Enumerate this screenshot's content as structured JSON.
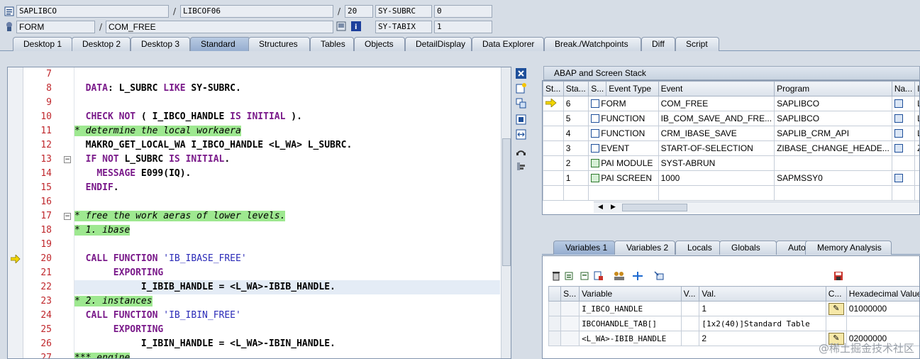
{
  "header": {
    "row1": {
      "program": "SAPLIBCO",
      "include": "LIBCOF06",
      "line": "20",
      "sysvar1": "SY-SUBRC",
      "sysval1": "0"
    },
    "row2": {
      "type": "FORM",
      "name": "COM_FREE",
      "sysvar2": "SY-TABIX",
      "sysval2": "1"
    },
    "sep": "/"
  },
  "tabs": [
    "Desktop 1",
    "Desktop 2",
    "Desktop 3",
    "Standard",
    "Structures",
    "Tables",
    "Objects",
    "DetailDisplay",
    "Data Explorer",
    "Break./Watchpoints",
    "Diff",
    "Script"
  ],
  "editor": {
    "lines": [
      {
        "no": "7",
        "text": ""
      },
      {
        "no": "8",
        "text": "  DATA: L_SUBRC LIKE SY-SUBRC."
      },
      {
        "no": "9",
        "text": ""
      },
      {
        "no": "10",
        "text": "  CHECK NOT ( I_IBCO_HANDLE IS INITIAL )."
      },
      {
        "no": "11",
        "text": "* determine the local workaera"
      },
      {
        "no": "12",
        "text": "  MAKRO_GET_LOCAL_WA I_IBCO_HANDLE <L_WA> L_SUBRC."
      },
      {
        "no": "13",
        "text": "  IF NOT L_SUBRC IS INITIAL."
      },
      {
        "no": "14",
        "text": "    MESSAGE E099(IQ)."
      },
      {
        "no": "15",
        "text": "  ENDIF."
      },
      {
        "no": "16",
        "text": ""
      },
      {
        "no": "17",
        "text": "* free the work aeras of lower levels."
      },
      {
        "no": "18",
        "text": "* 1. ibase"
      },
      {
        "no": "19",
        "text": ""
      },
      {
        "no": "20",
        "text": "  CALL FUNCTION 'IB_IBASE_FREE'"
      },
      {
        "no": "21",
        "text": "       EXPORTING"
      },
      {
        "no": "22",
        "text": "            I_IBIB_HANDLE = <L_WA>-IBIB_HANDLE."
      },
      {
        "no": "23",
        "text": "* 2. instances"
      },
      {
        "no": "24",
        "text": "  CALL FUNCTION 'IB_IBIN_FREE'"
      },
      {
        "no": "25",
        "text": "       EXPORTING"
      },
      {
        "no": "26",
        "text": "            I_IBIN_HANDLE = <L_WA>-IBIN_HANDLE."
      },
      {
        "no": "27",
        "text": "*** engine"
      }
    ]
  },
  "stack": {
    "title": "ABAP and Screen Stack",
    "columns": [
      "St...",
      "Sta...",
      "S...",
      "Event Type",
      "Event",
      "Program",
      "Na...",
      "I"
    ],
    "rows": [
      {
        "level": "6",
        "type": "FORM",
        "event": "COM_FREE",
        "program": "SAPLIBCO",
        "extra": "L"
      },
      {
        "level": "5",
        "type": "FUNCTION",
        "event": "IB_COM_SAVE_AND_FRE...",
        "program": "SAPLIBCO",
        "extra": "L"
      },
      {
        "level": "4",
        "type": "FUNCTION",
        "event": "CRM_IBASE_SAVE",
        "program": "SAPLIB_CRM_API",
        "extra": "L"
      },
      {
        "level": "3",
        "type": "EVENT",
        "event": "START-OF-SELECTION",
        "program": "ZIBASE_CHANGE_HEADE...",
        "extra": "Z"
      },
      {
        "level": "2",
        "type": "PAI MODULE",
        "event": "SYST-ABRUN",
        "program": "",
        "extra": ""
      },
      {
        "level": "1",
        "type": "PAI SCREEN",
        "event": "1000",
        "program": "SAPMSSY0",
        "extra": ""
      }
    ]
  },
  "vartabs": [
    "Variables 1",
    "Variables 2",
    "Locals",
    "Globals",
    "Auto",
    "Memory Analysis"
  ],
  "vars": {
    "columns": [
      "S...",
      "Variable",
      "V...",
      "Val.",
      "C...",
      "Hexadecimal Value"
    ],
    "rows": [
      {
        "name": "I_IBCO_HANDLE",
        "val": "1",
        "hex": "01000000"
      },
      {
        "name": "IBCOHANDLE_TAB[]",
        "val": "[1x2(40)]Standard Table",
        "hex": ""
      },
      {
        "name": "<L_WA>-IBIB_HANDLE",
        "val": "2",
        "hex": "02000000"
      }
    ]
  },
  "watermark": "@稀土掘金技术社区",
  "colors": {
    "comment_bg": "#9ee890",
    "keyword": "#7a1a8a",
    "linenum": "#c0282d",
    "active_tab": "#95adcf"
  }
}
